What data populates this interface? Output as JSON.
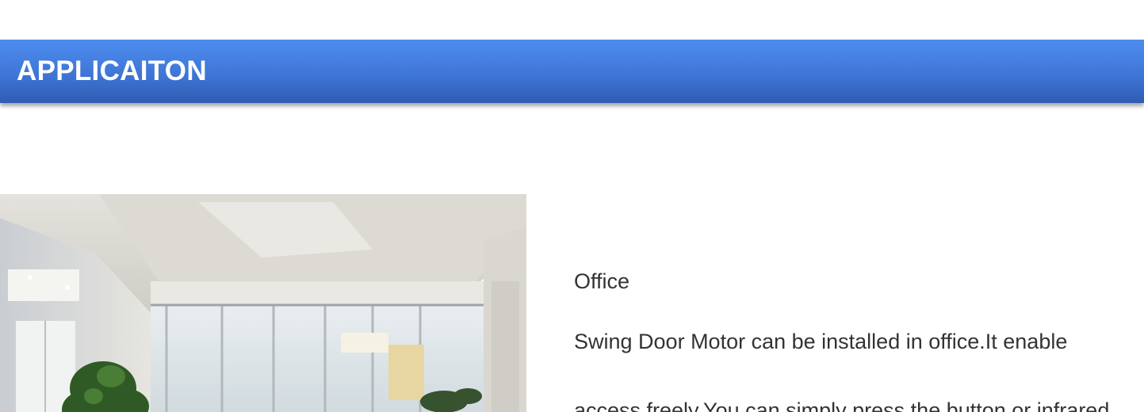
{
  "section": {
    "title": "APPLICAITON",
    "header_color": "#4a83e6"
  },
  "photo": {
    "icon": "office-lobby-photo"
  },
  "application": {
    "name": "Office",
    "description_line_1": "Swing Door Motor can be installed in office.It enable",
    "description_line_2": "access freely.You can simply press the button or infrared"
  }
}
